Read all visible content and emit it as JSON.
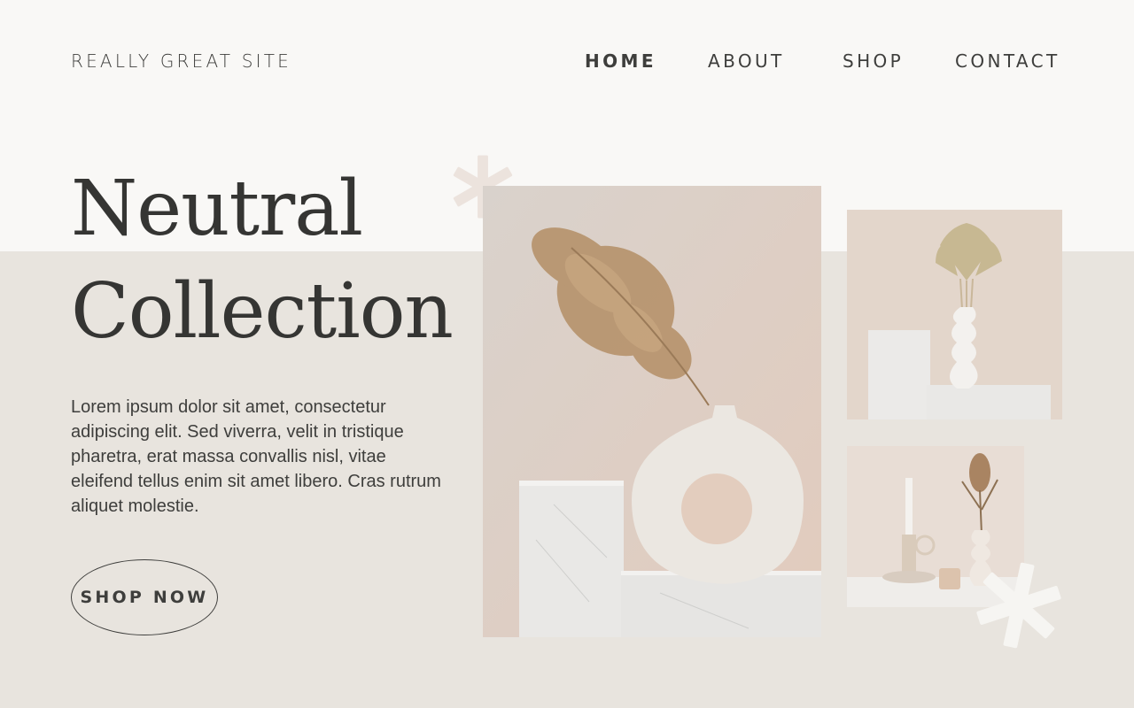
{
  "site": {
    "brand": "REALLY GREAT SITE"
  },
  "nav": {
    "items": [
      "HOME",
      "ABOUT",
      "SHOP",
      "CONTACT"
    ],
    "active": "HOME"
  },
  "hero": {
    "title_line1": "Neutral",
    "title_line2": "Collection",
    "description": "Lorem ipsum dolor sit amet, consectetur adipiscing elit. Sed viverra, velit in tristique pharetra, erat massa convallis nisl, vitae eleifend tellus enim sit amet libero. Cras rutrum aliquet molestie.",
    "cta": "SHOP NOW"
  },
  "colors": {
    "page_bg": "#e8e4de",
    "top_band": "#f9f8f6",
    "text": "#3e3e3c",
    "accent_star": "#ece3dd"
  },
  "images": [
    {
      "name": "pampas-donut-vase-photo"
    },
    {
      "name": "palm-leaf-vase-photo"
    },
    {
      "name": "candle-and-vase-photo"
    }
  ],
  "icons": [
    "asterisk-decoration-icon"
  ]
}
